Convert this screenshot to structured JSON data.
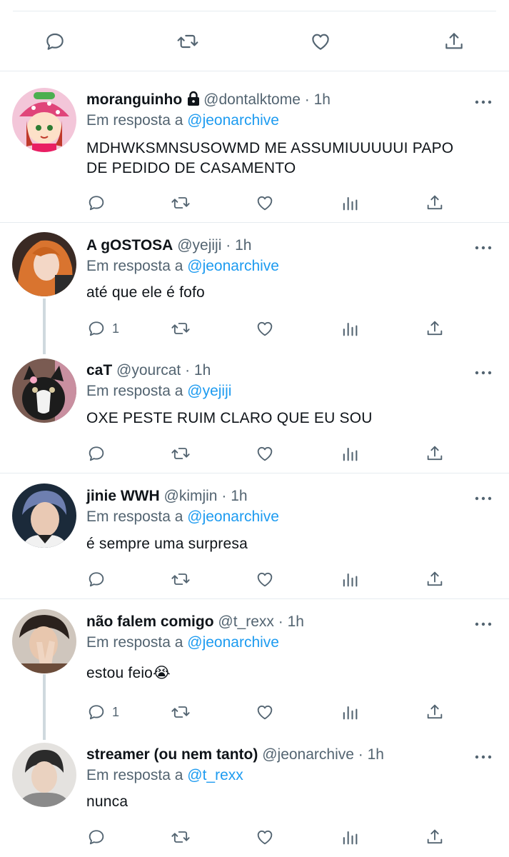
{
  "top_tweet": {
    "actions": [
      {
        "icon": "reply-icon"
      },
      {
        "icon": "retweet-icon"
      },
      {
        "icon": "like-icon"
      },
      {
        "icon": "share-icon"
      }
    ]
  },
  "replies": [
    {
      "name": "moranguinho",
      "handle": "@dontalktome",
      "dot": "·",
      "time": "1h",
      "locked": true,
      "reply_prefix": "Em resposta a",
      "reply_to": "@jeonarchive",
      "text_lines": [
        "MDHWKSMNSUSOWMD ME ASSUMIUUUUUI PAPO",
        "DE PEDIDO DE CASAMENTO"
      ],
      "reply_count": ""
    },
    {
      "name": "A gOSTOSA",
      "handle": "@yejiji",
      "dot": "·",
      "time": "1h",
      "reply_prefix": "Em resposta a",
      "reply_to": "@jeonarchive",
      "text_lines": [
        "até que ele é fofo"
      ],
      "reply_count": "1"
    },
    {
      "name": "caT",
      "handle": "@yourcat",
      "dot": "·",
      "time": "1h",
      "reply_prefix": "Em resposta a",
      "reply_to": "@yejiji",
      "text_lines": [
        "OXE PESTE RUIM CLARO QUE EU SOU"
      ],
      "reply_count": ""
    },
    {
      "name": "jinie WWH",
      "handle": "@kimjin",
      "dot": "·",
      "time": "1h",
      "reply_prefix": "Em resposta a",
      "reply_to": "@jeonarchive",
      "text_lines": [
        "é sempre uma surpresa"
      ],
      "reply_count": ""
    },
    {
      "name": "não falem comigo",
      "handle": "@t_rexx",
      "dot": "·",
      "time": "1h",
      "reply_prefix": "Em resposta a",
      "reply_to": "@jeonarchive",
      "text_lines": [
        "estou feio😭"
      ],
      "reply_count": "1"
    },
    {
      "name": "streamer (ou nem tanto)",
      "handle": "@jeonarchive",
      "dot": "·",
      "time": "1h",
      "reply_prefix": "Em resposta a",
      "reply_to": "@t_rexx",
      "text_lines": [
        "nunca"
      ],
      "reply_count": ""
    }
  ],
  "colors": {
    "mention": "#1d9bf0",
    "secondary": "#536471",
    "divider": "#e6ecf0"
  }
}
